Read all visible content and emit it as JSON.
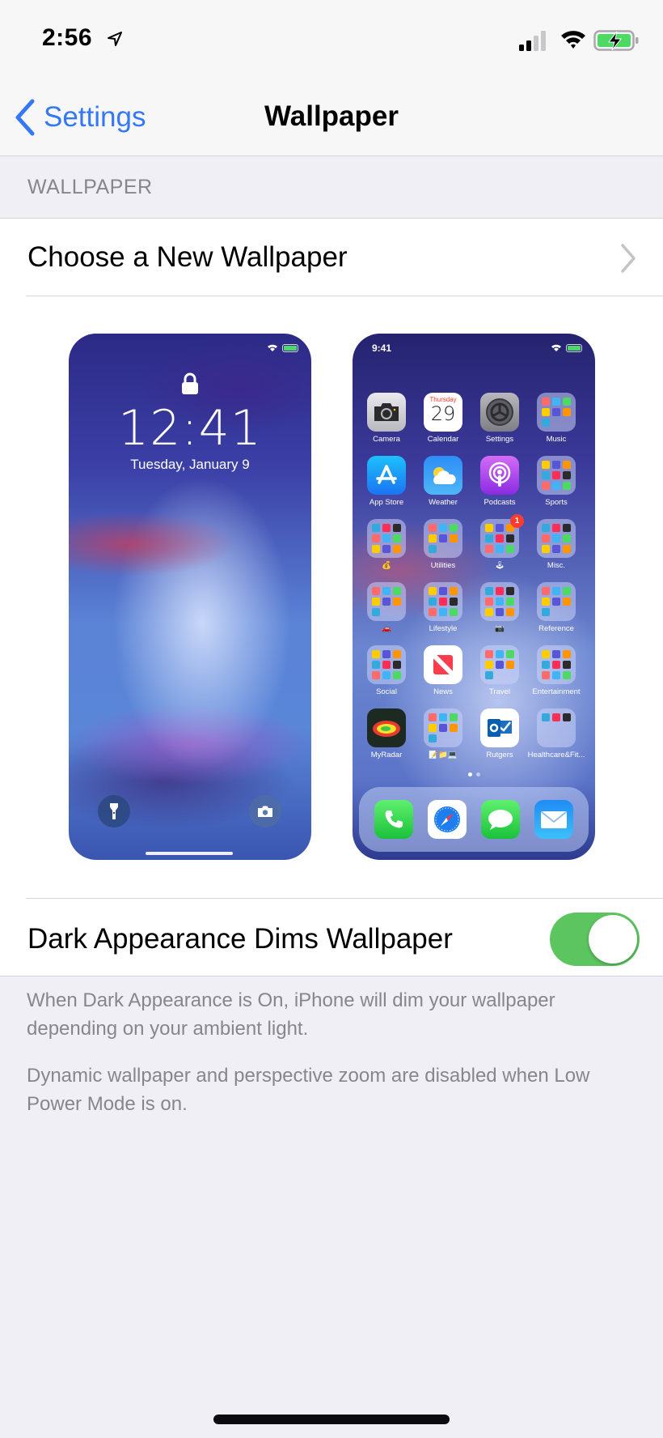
{
  "status_bar": {
    "time": "2:56",
    "location_icon": "location-arrow-icon",
    "signal_icon": "cellular-signal-icon",
    "signal_bars_active": 2,
    "signal_bars_total": 4,
    "wifi_icon": "wifi-icon",
    "battery_icon": "battery-charging-icon",
    "battery_color": "#4cd964"
  },
  "nav": {
    "back_label": "Settings",
    "title": "Wallpaper",
    "accent_color": "#3478f6"
  },
  "section": {
    "header": "WALLPAPER",
    "choose_label": "Choose a New Wallpaper"
  },
  "lock_preview": {
    "time": "12:41",
    "date": "Tuesday, January 9",
    "icons": [
      "lock-icon",
      "flashlight-icon",
      "camera-icon"
    ]
  },
  "home_preview": {
    "time": "9:41",
    "apps": [
      {
        "label": "Camera",
        "type": "app",
        "icon": "camera-app-icon"
      },
      {
        "label": "Calendar",
        "type": "app",
        "icon": "calendar-app-icon",
        "day_name": "Thursday",
        "day_number": "29"
      },
      {
        "label": "Settings",
        "type": "app",
        "icon": "settings-app-icon"
      },
      {
        "label": "Music",
        "type": "folder"
      },
      {
        "label": "App Store",
        "type": "app",
        "icon": "app-store-icon"
      },
      {
        "label": "Weather",
        "type": "app",
        "icon": "weather-app-icon"
      },
      {
        "label": "Podcasts",
        "type": "app",
        "icon": "podcasts-app-icon"
      },
      {
        "label": "Sports",
        "type": "folder"
      },
      {
        "label": "💰",
        "type": "folder"
      },
      {
        "label": "Utilities",
        "type": "folder"
      },
      {
        "label": "🕹",
        "type": "folder",
        "badge": "1"
      },
      {
        "label": "Misc.",
        "type": "folder"
      },
      {
        "label": "🚗",
        "type": "folder"
      },
      {
        "label": "Lifestyle",
        "type": "folder"
      },
      {
        "label": "📷",
        "type": "folder"
      },
      {
        "label": "Reference",
        "type": "folder"
      },
      {
        "label": "Social",
        "type": "folder"
      },
      {
        "label": "News",
        "type": "app",
        "icon": "news-app-icon"
      },
      {
        "label": "Travel",
        "type": "folder"
      },
      {
        "label": "Entertainment",
        "type": "folder"
      },
      {
        "label": "MyRadar",
        "type": "app",
        "icon": "myradar-app-icon"
      },
      {
        "label": "📝📁💻",
        "type": "folder"
      },
      {
        "label": "Rutgers",
        "type": "app",
        "icon": "outlook-app-icon"
      },
      {
        "label": "Healthcare&Fit...",
        "type": "folder"
      }
    ],
    "page_count": 2,
    "current_page": 1,
    "dock": [
      {
        "name": "Phone",
        "icon": "phone-app-icon"
      },
      {
        "name": "Safari",
        "icon": "safari-app-icon"
      },
      {
        "name": "Messages",
        "icon": "messages-app-icon"
      },
      {
        "name": "Mail",
        "icon": "mail-app-icon"
      }
    ]
  },
  "dark_dims": {
    "label": "Dark Appearance Dims Wallpaper",
    "enabled": true,
    "toggle_color": "#5cc560"
  },
  "footnotes": {
    "dark_note": "When Dark Appearance is On, iPhone will dim your wallpaper depending on your ambient light.",
    "low_power_note": "Dynamic wallpaper and perspective zoom are disabled when Low Power Mode is on."
  }
}
